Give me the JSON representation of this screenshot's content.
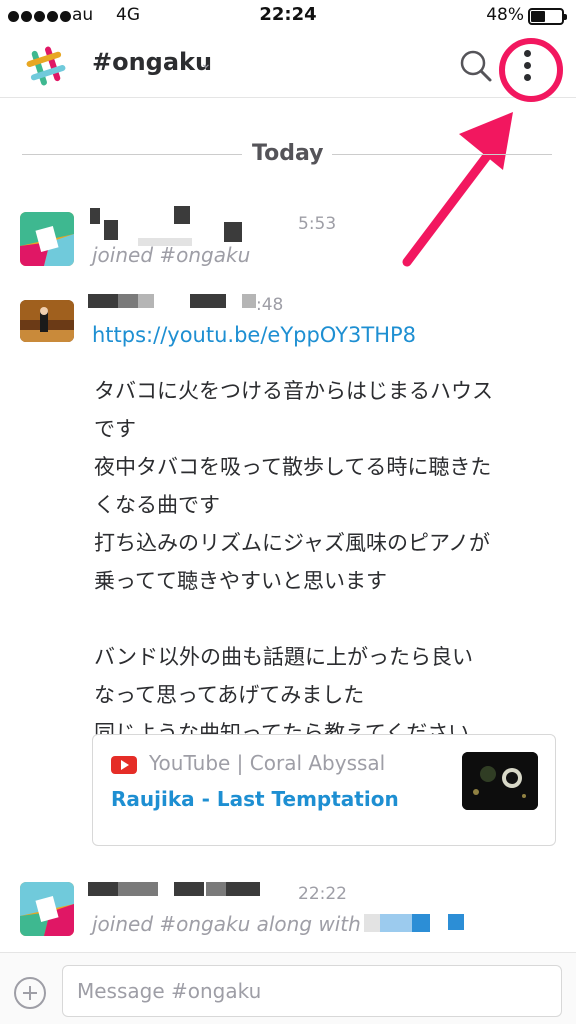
{
  "status_bar": {
    "carrier": "au",
    "network": "4G",
    "time": "22:24",
    "battery_percent_text": "48%",
    "battery_level": 0.48
  },
  "header": {
    "channel_name": "#ongaku",
    "caret": "⌄",
    "search_icon": "search-icon",
    "more_icon": "vertical-ellipsis-icon"
  },
  "divider": {
    "label": "Today"
  },
  "messages": [
    {
      "time": "5:53",
      "system_text": "joined #ongaku"
    },
    {
      "time": ":48",
      "link": "https://youtu.be/eYppOY3THP8",
      "body_lines": [
        "タバコに火をつける音からはじまるハウス",
        "です",
        "夜中タバコを吸って散歩してる時に聴きた",
        "くなる曲です",
        "打ち込みのリズムにジャズ風味のピアノが",
        "乗ってて聴きやすいと思います",
        "",
        "バンド以外の曲も話題に上がったら良い",
        "なって思ってあげてみました",
        "同じような曲知ってたら教えてください"
      ],
      "attachment": {
        "source": "YouTube | Coral Abyssal",
        "title": "Raujika - Last Temptation"
      }
    },
    {
      "time": "22:22",
      "system_text": "joined #ongaku along with"
    }
  ],
  "composer": {
    "placeholder": "Message #ongaku"
  },
  "colors": {
    "link": "#1e8fd2",
    "annotation": "#f2175f",
    "muted": "#9e9ea6"
  }
}
